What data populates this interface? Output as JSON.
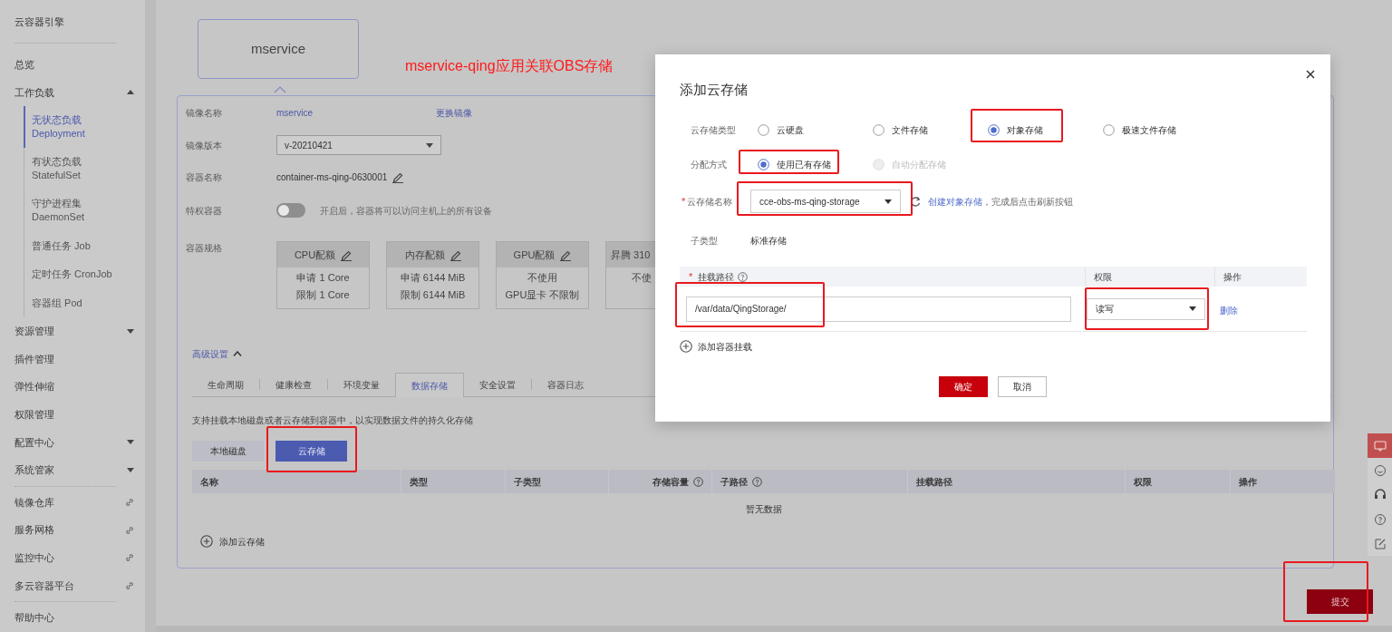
{
  "sidebar": {
    "title": "云容器引擎",
    "sections": [
      [
        {
          "label": "总览",
          "kind": "plain"
        },
        {
          "label": "工作负载",
          "kind": "group",
          "expanded": true,
          "children": [
            {
              "label": "无状态负载",
              "sub": "Deployment",
              "selected": true
            },
            {
              "label": "有状态负载",
              "sub": "StatefulSet",
              "selected": false
            },
            {
              "label": "守护进程集",
              "sub": "DaemonSet",
              "selected": false
            },
            {
              "label": "普通任务 Job",
              "selected": false
            },
            {
              "label": "定时任务 CronJob",
              "selected": false
            },
            {
              "label": "容器组 Pod",
              "selected": false
            }
          ]
        },
        {
          "label": "资源管理",
          "kind": "group",
          "expanded": false
        },
        {
          "label": "插件管理",
          "kind": "plain"
        },
        {
          "label": "弹性伸缩",
          "kind": "plain"
        },
        {
          "label": "权限管理",
          "kind": "plain"
        },
        {
          "label": "配置中心",
          "kind": "group",
          "expanded": false
        },
        {
          "label": "系统管家",
          "kind": "group",
          "expanded": false
        }
      ],
      [
        {
          "label": "镜像仓库",
          "kind": "link"
        },
        {
          "label": "服务网格",
          "kind": "link"
        },
        {
          "label": "监控中心",
          "kind": "link"
        },
        {
          "label": "多云容器平台",
          "kind": "link"
        }
      ],
      [
        {
          "label": "帮助中心",
          "kind": "plain"
        }
      ]
    ]
  },
  "container_card": "mservice",
  "annotation": "mservice-qing应用关联OBS存储",
  "container": {
    "image_name": {
      "label": "镜像名称",
      "value": "mservice",
      "action": "更换镜像"
    },
    "image_version": {
      "label": "镜像版本",
      "value": "v-20210421"
    },
    "container_name": {
      "label": "容器名称",
      "value": "container-ms-qing-0630001"
    },
    "privileged": {
      "label": "特权容器",
      "on": false,
      "hint": "开启后，容器将可以访问主机上的所有设备"
    },
    "spec": {
      "label": "容器规格",
      "cards": [
        {
          "title": "CPU配额",
          "lines": [
            "申请 1 Core",
            "限制 1 Core"
          ],
          "clipped": false
        },
        {
          "title": "内存配额",
          "lines": [
            "申请 6144 MiB",
            "限制 6144 MiB"
          ],
          "clipped": false
        },
        {
          "title": "GPU配额",
          "lines": [
            "不使用",
            "GPU显卡 不限制"
          ],
          "clipped": false
        },
        {
          "title": "昇腾 310",
          "lines": [
            "不使"
          ],
          "clipped": true
        }
      ]
    }
  },
  "advanced": {
    "label": "高级设置",
    "expanded": true
  },
  "tabs": [
    {
      "label": "生命周期",
      "selected": false
    },
    {
      "label": "健康检查",
      "selected": false
    },
    {
      "label": "环境变量",
      "selected": false
    },
    {
      "label": "数据存储",
      "selected": true
    },
    {
      "label": "安全设置",
      "selected": false
    },
    {
      "label": "容器日志",
      "selected": false
    }
  ],
  "storage": {
    "description": "支持挂载本地磁盘或者云存储到容器中，以实现数据文件的持久化存储",
    "modes": [
      {
        "label": "本地磁盘",
        "selected": false
      },
      {
        "label": "云存储",
        "selected": true
      }
    ],
    "columns": [
      {
        "label": "名称",
        "kind": "plain"
      },
      {
        "label": "类型",
        "kind": "plain"
      },
      {
        "label": "子类型",
        "kind": "plain"
      },
      {
        "label": "存储容量",
        "kind": "help"
      },
      {
        "label": "子路径",
        "kind": "help"
      },
      {
        "label": "挂载路径",
        "kind": "plain"
      },
      {
        "label": "权限",
        "kind": "plain"
      },
      {
        "label": "操作",
        "kind": "plain"
      }
    ],
    "empty": "暂无数据",
    "add": "添加云存储"
  },
  "submit": "提交",
  "dialog": {
    "title": "添加云存储",
    "radio_groups": [
      {
        "label": "云存储类型",
        "options": [
          {
            "label": "云硬盘",
            "selected": false,
            "disabled": false
          },
          {
            "label": "文件存储",
            "selected": false,
            "disabled": false
          },
          {
            "label": "对象存储",
            "selected": true,
            "disabled": false
          },
          {
            "label": "极速文件存储",
            "selected": false,
            "disabled": false
          }
        ]
      },
      {
        "label": "分配方式",
        "options": [
          {
            "label": "使用已有存储",
            "selected": true,
            "disabled": false
          },
          {
            "label": "自动分配存储",
            "selected": false,
            "disabled": true
          }
        ]
      }
    ],
    "storage_name": {
      "label": "云存储名称",
      "required_mark": "*",
      "value": "cce-obs-ms-qing-storage",
      "link": "创建对象存储",
      "hint": "，完成后点击刷新按钮"
    },
    "subtype": {
      "label": "子类型",
      "value": "标准存储"
    },
    "mounts": {
      "columns": [
        {
          "label": "挂载路径",
          "required_mark": "*",
          "kind": "help"
        },
        {
          "label": "权限",
          "kind": "plain"
        },
        {
          "label": "操作",
          "kind": "plain"
        }
      ],
      "rows": [
        {
          "path": "/var/data/QingStorage/",
          "permission": "读写",
          "action": "删除"
        }
      ],
      "add": "添加容器挂载"
    },
    "buttons": [
      {
        "label": "确定",
        "kind": "primary"
      },
      {
        "label": "取消",
        "kind": "secondary"
      }
    ]
  }
}
